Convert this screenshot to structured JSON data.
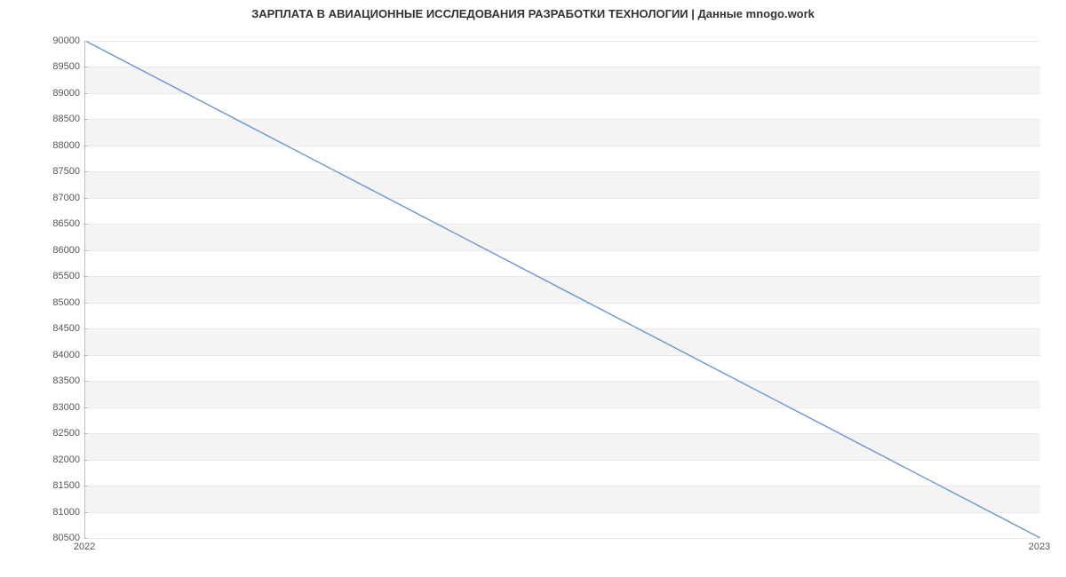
{
  "chart_data": {
    "type": "line",
    "title": "ЗАРПЛАТА В АВИАЦИОННЫЕ ИССЛЕДОВАНИЯ РАЗРАБОТКИ ТЕХНОЛОГИИ | Данные mnogo.work",
    "x": [
      "2022",
      "2023"
    ],
    "values": [
      90000,
      80500
    ],
    "xlabel": "",
    "ylabel": "",
    "ylim": [
      80500,
      90000
    ],
    "y_ticks": [
      90000,
      89500,
      89000,
      88500,
      88000,
      87500,
      87000,
      86500,
      86000,
      85500,
      85000,
      84500,
      84000,
      83500,
      83000,
      82500,
      82000,
      81500,
      81000,
      80500
    ],
    "x_ticks": [
      "2022",
      "2023"
    ],
    "line_color": "#6c96cf"
  }
}
